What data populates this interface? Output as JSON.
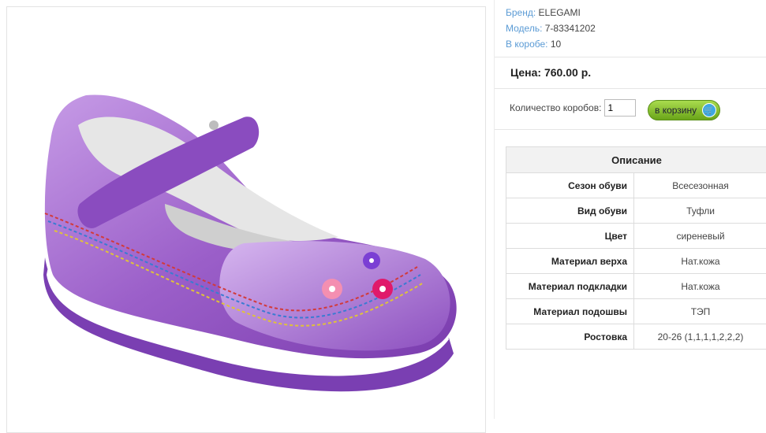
{
  "product": {
    "brand_label": "Бренд:",
    "brand_value": "ELEGAMI",
    "model_label": "Модель:",
    "model_value": "7-83341202",
    "box_label": "В коробе:",
    "box_value": "10"
  },
  "price": {
    "text": "Цена: 760.00 р."
  },
  "order": {
    "qty_label": "Количество коробов:",
    "qty_value": "1",
    "cart_label": "в корзину"
  },
  "description": {
    "title": "Описание",
    "rows": [
      {
        "label": "Сезон обуви",
        "value": "Всесезонная"
      },
      {
        "label": "Вид обуви",
        "value": "Туфли"
      },
      {
        "label": "Цвет",
        "value": "сиреневый"
      },
      {
        "label": "Материал верха",
        "value": "Нат.кожа"
      },
      {
        "label": "Материал подкладки",
        "value": "Нат.кожа"
      },
      {
        "label": "Материал подошвы",
        "value": "ТЭП"
      },
      {
        "label": "Ростовка",
        "value": "20-26 (1,1,1,1,2,2,2)"
      }
    ]
  },
  "colors": {
    "link": "#5b9bd5",
    "button": "#8cc63f",
    "shoe": "#9b5fc9"
  }
}
